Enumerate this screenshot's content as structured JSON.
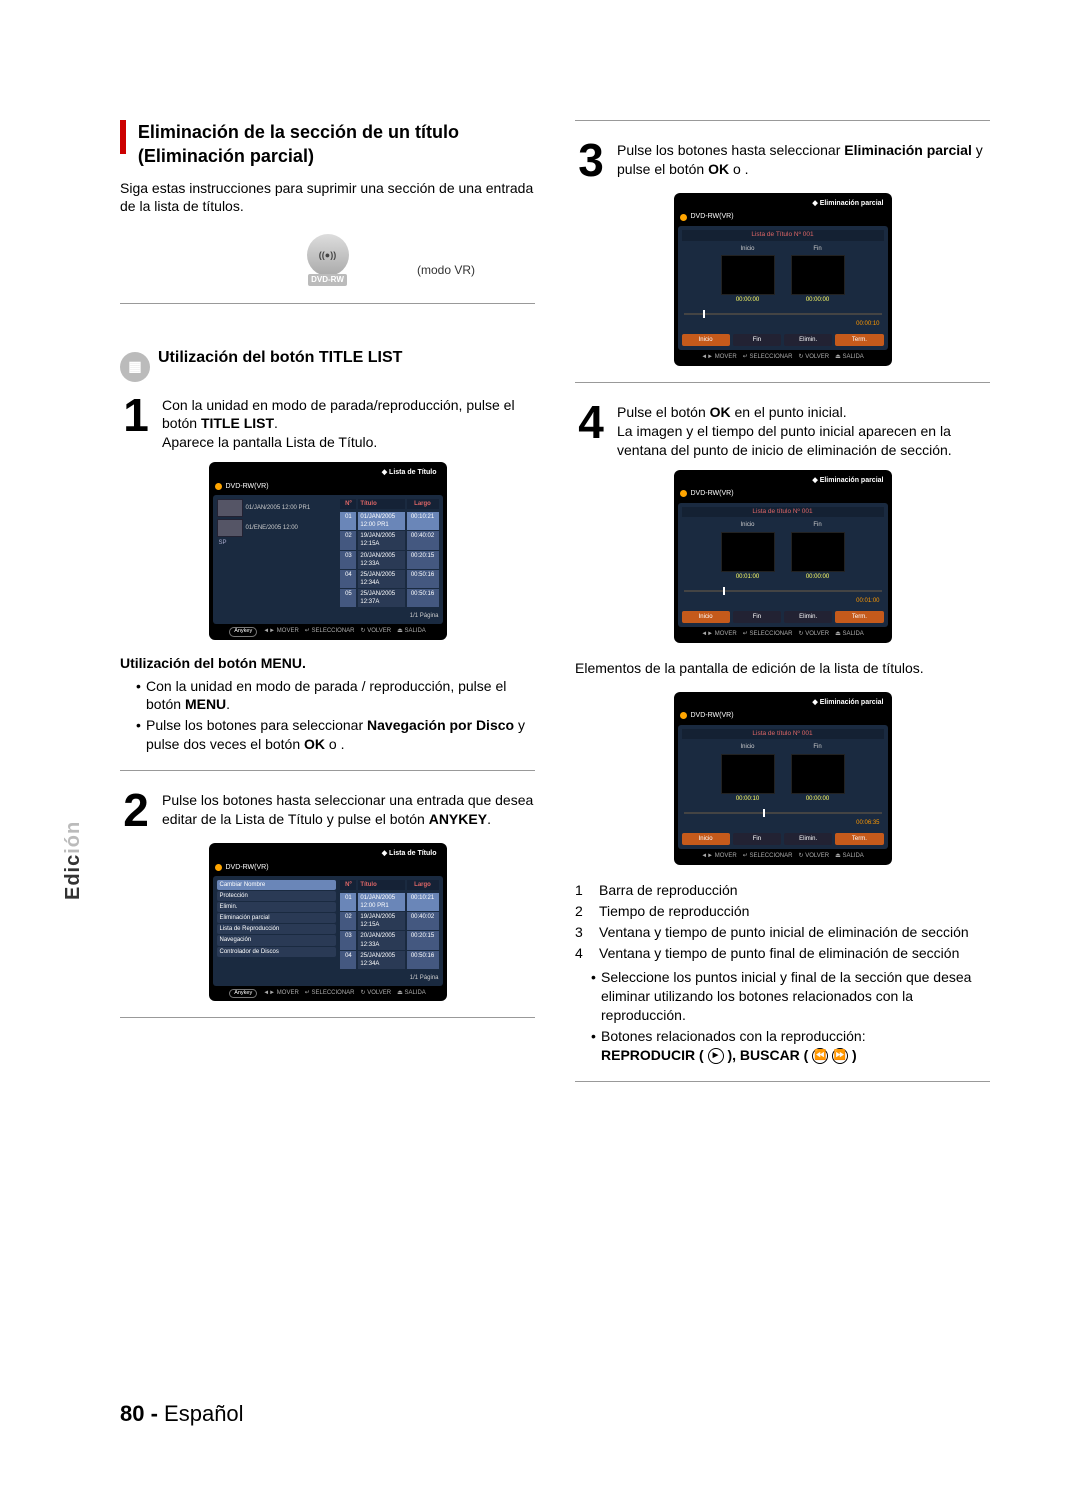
{
  "tab": {
    "prefix": "Edic",
    "suffix": "ión"
  },
  "footer": {
    "page": "80 -",
    "lang": "Español"
  },
  "left": {
    "title": "Eliminación de la sección de un título (Eliminación parcial)",
    "intro": "Siga estas instrucciones para suprimir una sección de una entrada de la lista de títulos.",
    "rw_label": "DVD-RW",
    "mode": "(modo VR)",
    "subsection": "Utilización del botón TITLE LIST",
    "step1": {
      "num": "1",
      "a": "Con la unidad en modo de parada/reproducción, pulse el botón ",
      "b": "TITLE LIST",
      "c": ".",
      "d": "Aparece la pantalla Lista de Título."
    },
    "screen1": {
      "title": "Lista de Título",
      "disc": "DVD-RW(VR)",
      "head_no": "Nº",
      "head_title": "Título",
      "head_len": "Largo",
      "rows": [
        {
          "n": "01",
          "t": "01/JAN/2005 12:00 PR1",
          "l": "00:10:21"
        },
        {
          "n": "02",
          "t": "19/JAN/2005 12:15A",
          "l": "00:40:02"
        },
        {
          "n": "03",
          "t": "20/JAN/2005 12:33A",
          "l": "00:20:15"
        },
        {
          "n": "04",
          "t": "25/JAN/2005 12:34A",
          "l": "00:50:16"
        },
        {
          "n": "05",
          "t": "25/JAN/2005 12:37A",
          "l": "00:50:16"
        }
      ],
      "thumbs": [
        {
          "t": "01/JAN/2005 12:00 PR1"
        },
        {
          "t": "01/ENE/2005 12:00"
        }
      ],
      "sp": "SP",
      "page": "1/1 Página",
      "anykey": "Anykey",
      "foot_move": "MOVER",
      "foot_sel": "SELECCIONAR",
      "foot_back": "VOLVER",
      "foot_exit": "SALIDA"
    },
    "menu_sub": "Utilización del botón MENU.",
    "menu_b1a": "Con la unidad en modo de parada / reproducción, pulse el botón ",
    "menu_b1b": "MENU",
    "menu_b1c": ".",
    "menu_b2a": "Pulse los botones ",
    "menu_b2b": " para seleccionar ",
    "menu_b2c": "Navegación por Disco",
    "menu_b2d": " y pulse dos veces el botón ",
    "menu_b2e": "OK",
    "menu_b2f": " o ",
    "menu_b2g": ".",
    "step2": {
      "num": "2",
      "a": "Pulse los botones ",
      "b": " hasta seleccionar una entrada que desea editar de la Lista de Título y pulse el botón ",
      "c": "ANYKEY",
      "d": "."
    },
    "screen2": {
      "title": "Lista de Título",
      "disc": "DVD-RW(VR)",
      "head_no": "Nº",
      "head_title": "Título",
      "head_len": "Largo",
      "menu": [
        "Cambiar Nombre",
        "Protección",
        "Elimin.",
        "Eliminación parcial",
        "Lista de Reproducción",
        "Navegación",
        "Controlador de Discos"
      ],
      "rows": [
        {
          "n": "01",
          "t": "01/JAN/2005 12:00 PR1",
          "l": "00:10:21"
        },
        {
          "n": "02",
          "t": "19/JAN/2005 12:15A",
          "l": "00:40:02"
        },
        {
          "n": "03",
          "t": "20/JAN/2005 12:33A",
          "l": "00:20:15"
        },
        {
          "n": "04",
          "t": "25/JAN/2005 12:34A",
          "l": "00:50:16"
        }
      ],
      "page": "1/1 Página",
      "anykey": "Anykey",
      "foot_move": "MOVER",
      "foot_sel": "SELECCIONAR",
      "foot_back": "VOLVER",
      "foot_exit": "SALIDA"
    }
  },
  "right": {
    "step3": {
      "num": "3",
      "a": "Pulse los botones ",
      "b": " hasta seleccionar ",
      "c": "Eliminación parcial",
      "d": " y pulse el botón ",
      "e": "OK",
      "f": " o ",
      "g": "."
    },
    "ep_title": "Eliminación parcial",
    "ep_disc": "DVD-RW(VR)",
    "ep_listline": "Lista de Título Nº  001",
    "ep_listline_b": "Lista de título Nº  001",
    "lab_start": "Inicio",
    "lab_end": "Fin",
    "btn_start": "Inicio",
    "btn_end": "Fin",
    "btn_del": "Elimin.",
    "btn_term": "Term.",
    "foot_move": "MOVER",
    "foot_sel": "SELECCIONAR",
    "foot_back": "VOLVER",
    "foot_exit": "SALIDA",
    "sc3": {
      "t_start": "00:00:00",
      "t_end": "00:00:00",
      "clock": "00:00:10",
      "head": "10%"
    },
    "step4": {
      "num": "4",
      "a": "Pulse el botón ",
      "b": "OK",
      "c": " en el punto inicial.",
      "d": "La imagen y el tiempo del punto inicial aparecen en la ventana del punto de inicio de eliminación de sección."
    },
    "sc4": {
      "t_start": "00:01:00",
      "t_end": "00:00:00",
      "clock": "00:01:00",
      "head": "20%"
    },
    "elements_intro": "Elementos de la pantalla de edición de la lista de títulos.",
    "sc5": {
      "t_start": "00:00:10",
      "t_end": "00:00:00",
      "clock": "00:06:35",
      "head": "40%"
    },
    "keys": [
      {
        "n": "1",
        "t": "Barra de reproducción"
      },
      {
        "n": "2",
        "t": "Tiempo de reproducción"
      },
      {
        "n": "3",
        "t": "Ventana y tiempo de punto inicial de eliminación de sección"
      },
      {
        "n": "4",
        "t": "Ventana y tiempo de punto final de eliminación de sección"
      }
    ],
    "tip1": "Seleccione los puntos inicial y final de la sección que desea eliminar utilizando los botones relacionados con la reproducción.",
    "tip2a": "Botones relacionados con la reproducción:",
    "tip2b": "REPRODUCIR ( ",
    "tip2c": " ), BUSCAR ( ",
    "tip2d": " )"
  },
  "glyphs": {
    "play": "►",
    "rewind": "⏪",
    "fwd": "⏩",
    "left": "◄",
    "right": "►",
    "enter": "↵",
    "diamond": "◆"
  }
}
